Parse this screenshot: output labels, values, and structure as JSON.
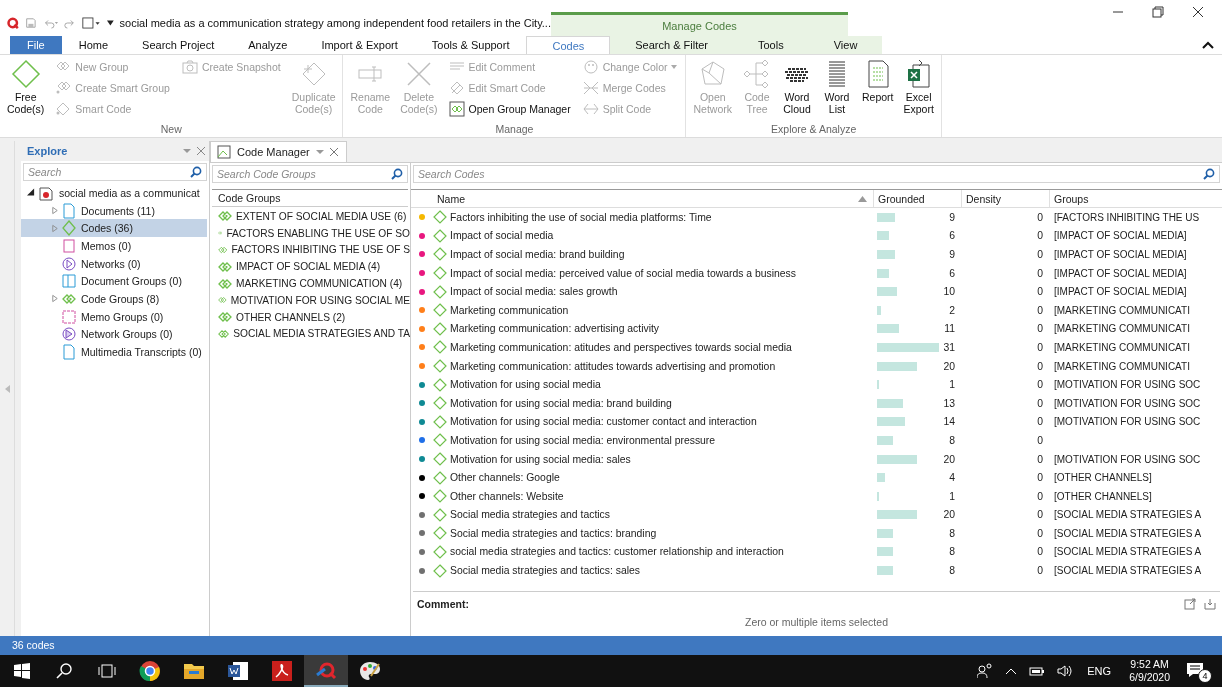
{
  "title_bar": {
    "title": "social media as a communication strategy among independent food retailers in the City...",
    "context_label": "Manage Codes"
  },
  "tabs": [
    {
      "label": "File",
      "kind": "file",
      "selected": false
    },
    {
      "label": "Home",
      "kind": "main",
      "selected": false
    },
    {
      "label": "Search Project",
      "kind": "main",
      "selected": false
    },
    {
      "label": "Analyze",
      "kind": "main",
      "selected": false
    },
    {
      "label": "Import & Export",
      "kind": "main",
      "selected": false
    },
    {
      "label": "Tools & Support",
      "kind": "main",
      "selected": false
    },
    {
      "label": "Codes",
      "kind": "context",
      "selected": true
    },
    {
      "label": "Search & Filter",
      "kind": "context",
      "selected": false
    },
    {
      "label": "Tools",
      "kind": "context",
      "selected": false
    },
    {
      "label": "View",
      "kind": "context",
      "selected": false
    }
  ],
  "ribbon": {
    "groups": [
      {
        "label": "New",
        "controls": [
          {
            "kind": "large",
            "label": "Free Code(s)",
            "disabled": false
          },
          {
            "kind": "stack",
            "items": [
              {
                "label": "New Group",
                "disabled": true,
                "menu": false
              },
              {
                "label": "Create Smart Group",
                "disabled": true,
                "menu": false
              },
              {
                "label": "Smart Code",
                "disabled": true,
                "menu": false
              }
            ]
          },
          {
            "kind": "stack",
            "items": [
              {
                "label": "Create Snapshot",
                "disabled": true,
                "menu": false
              }
            ]
          },
          {
            "kind": "large",
            "label": "Duplicate Code(s)",
            "disabled": true
          }
        ]
      },
      {
        "label": "Manage",
        "controls": [
          {
            "kind": "large",
            "label": "Rename Code",
            "disabled": true
          },
          {
            "kind": "large",
            "label": "Delete Code(s)",
            "disabled": true
          },
          {
            "kind": "stack",
            "items": [
              {
                "label": "Edit Comment",
                "disabled": true,
                "menu": false
              },
              {
                "label": "Edit Smart Code",
                "disabled": true,
                "menu": false
              },
              {
                "label": "Open Group Manager",
                "disabled": false,
                "menu": false
              }
            ]
          },
          {
            "kind": "stack",
            "items": [
              {
                "label": "Change Color",
                "disabled": true,
                "menu": true
              },
              {
                "label": "Merge Codes",
                "disabled": true,
                "menu": false
              },
              {
                "label": "Split Code",
                "disabled": true,
                "menu": false
              }
            ]
          }
        ]
      },
      {
        "label": "Explore & Analyze",
        "controls": [
          {
            "kind": "large",
            "label": "Open Network",
            "disabled": true
          },
          {
            "kind": "large",
            "label": "Code Tree",
            "disabled": true
          },
          {
            "kind": "large",
            "label": "Word Cloud",
            "disabled": false
          },
          {
            "kind": "large",
            "label": "Word List",
            "disabled": false
          },
          {
            "kind": "large",
            "label": "Report",
            "disabled": false
          },
          {
            "kind": "large",
            "label": "Excel Export",
            "disabled": false
          }
        ]
      }
    ]
  },
  "explorer": {
    "title": "Explore",
    "search": {
      "placeholder": "Search"
    },
    "tree": [
      {
        "label": "social media as a communicat",
        "expanded": true,
        "has_children": true,
        "selected": false,
        "children": [
          {
            "label": "Documents (11)",
            "has_children": true,
            "expanded": false,
            "selected": false
          },
          {
            "label": "Codes (36)",
            "has_children": true,
            "expanded": false,
            "selected": true
          },
          {
            "label": "Memos (0)",
            "has_children": false,
            "selected": false
          },
          {
            "label": "Networks (0)",
            "has_children": false,
            "selected": false
          },
          {
            "label": "Document Groups (0)",
            "has_children": false,
            "selected": false
          },
          {
            "label": "Code Groups (8)",
            "has_children": true,
            "expanded": false,
            "selected": false
          },
          {
            "label": "Memo Groups (0)",
            "has_children": false,
            "selected": false
          },
          {
            "label": "Network Groups (0)",
            "has_children": false,
            "selected": false
          },
          {
            "label": "Multimedia Transcripts (0)",
            "has_children": false,
            "selected": false
          }
        ]
      }
    ]
  },
  "document_tab": {
    "label": "Code Manager"
  },
  "code_groups": {
    "search": {
      "placeholder": "Search Code Groups"
    },
    "header": "Code Groups",
    "items": [
      "EXTENT OF SOCIAL MEDIA USE (6)",
      "FACTORS ENABLING THE USE OF SO",
      "FACTORS INHIBITING THE USE OF S",
      "IMPACT OF SOCIAL MEDIA (4)",
      "MARKETING COMMUNICATION (4)",
      "MOTIVATION FOR USING SOCIAL ME",
      "OTHER CHANNELS (2)",
      "SOCIAL MEDIA STRATEGIES AND TA"
    ]
  },
  "codes": {
    "search": {
      "placeholder": "Search Codes"
    },
    "columns": [
      {
        "label": "Name",
        "sorted": true
      },
      {
        "label": "Grounded",
        "sorted": false
      },
      {
        "label": "Density",
        "sorted": false
      },
      {
        "label": "Groups",
        "sorted": false
      }
    ],
    "rows": [
      {
        "color": "#f5b800",
        "name": "Factors inhibiting the use of social media platforms: Time",
        "grounded": "9",
        "density": "0",
        "groups": "[FACTORS INHIBITING THE US"
      },
      {
        "color": "#e8177f",
        "name": "Impact of social media",
        "grounded": "6",
        "density": "0",
        "groups": "[IMPACT OF SOCIAL MEDIA]"
      },
      {
        "color": "#e8177f",
        "name": "Impact of social media: brand building",
        "grounded": "9",
        "density": "0",
        "groups": "[IMPACT OF SOCIAL MEDIA]"
      },
      {
        "color": "#e8177f",
        "name": "Impact of social media: perceived value of social media towards a business",
        "grounded": "6",
        "density": "0",
        "groups": "[IMPACT OF SOCIAL MEDIA]"
      },
      {
        "color": "#e8177f",
        "name": "Impact of social media: sales growth",
        "grounded": "10",
        "density": "0",
        "groups": "[IMPACT OF SOCIAL MEDIA]"
      },
      {
        "color": "#ff7f1a",
        "name": "Marketing communication",
        "grounded": "2",
        "density": "0",
        "groups": "[MARKETING COMMUNICATI"
      },
      {
        "color": "#ff7f1a",
        "name": "Marketing communication: advertising activity",
        "grounded": "11",
        "density": "0",
        "groups": "[MARKETING COMMUNICATI"
      },
      {
        "color": "#ff7f1a",
        "name": "Marketing communication: atitudes and perspectives towards social media",
        "grounded": "31",
        "density": "0",
        "groups": "[MARKETING COMMUNICATI"
      },
      {
        "color": "#ff7f1a",
        "name": "Marketing communication: attitudes towards advertising and promotion",
        "grounded": "20",
        "density": "0",
        "groups": "[MARKETING COMMUNICATI"
      },
      {
        "color": "#0f8a94",
        "name": "Motivation for using social media",
        "grounded": "1",
        "density": "0",
        "groups": "[MOTIVATION FOR USING SOC"
      },
      {
        "color": "#0f8a94",
        "name": "Motivation for using social media: brand building",
        "grounded": "13",
        "density": "0",
        "groups": "[MOTIVATION FOR USING SOC"
      },
      {
        "color": "#0f8a94",
        "name": "Motivation for using social media: customer contact and interaction",
        "grounded": "14",
        "density": "0",
        "groups": "[MOTIVATION FOR USING SOC"
      },
      {
        "color": "#1f6fe8",
        "name": "Motivation for using social media: environmental pressure",
        "grounded": "8",
        "density": "0"
      },
      {
        "color": "#0f8a94",
        "name": "Motivation for using social media: sales",
        "grounded": "20",
        "density": "0",
        "groups": "[MOTIVATION FOR USING SOC"
      },
      {
        "color": "#000000",
        "name": "Other channels: Google",
        "grounded": "4",
        "density": "0",
        "groups": "[OTHER CHANNELS]"
      },
      {
        "color": "#000000",
        "name": "Other channels: Website",
        "grounded": "1",
        "density": "0",
        "groups": "[OTHER CHANNELS]"
      },
      {
        "color": "#707070",
        "name": "Social media strategies and tactics",
        "grounded": "20",
        "density": "0",
        "groups": "[SOCIAL MEDIA STRATEGIES A"
      },
      {
        "color": "#707070",
        "name": "Social media strategies and tactics: branding",
        "grounded": "8",
        "density": "0",
        "groups": "[SOCIAL MEDIA STRATEGIES A"
      },
      {
        "color": "#707070",
        "name": "social media strategies and tactics: customer relationship and interaction",
        "grounded": "8",
        "density": "0",
        "groups": "[SOCIAL MEDIA STRATEGIES A"
      },
      {
        "color": "#707070",
        "name": "Social media strategies and tactics: sales",
        "grounded": "8",
        "density": "0",
        "groups": "[SOCIAL MEDIA STRATEGIES A"
      }
    ],
    "comment": {
      "label": "Comment:",
      "text": "Zero or multiple items selected"
    }
  },
  "status_bar": {
    "text": "36 codes"
  },
  "taskbar": {
    "apps": [
      {
        "selected": false
      },
      {
        "selected": false
      },
      {
        "selected": false
      },
      {
        "selected": false
      },
      {
        "selected": true
      },
      {
        "selected": false
      }
    ],
    "language": "ENG",
    "time": "9:52 AM",
    "date": "6/9/2020",
    "notifications": "4"
  }
}
